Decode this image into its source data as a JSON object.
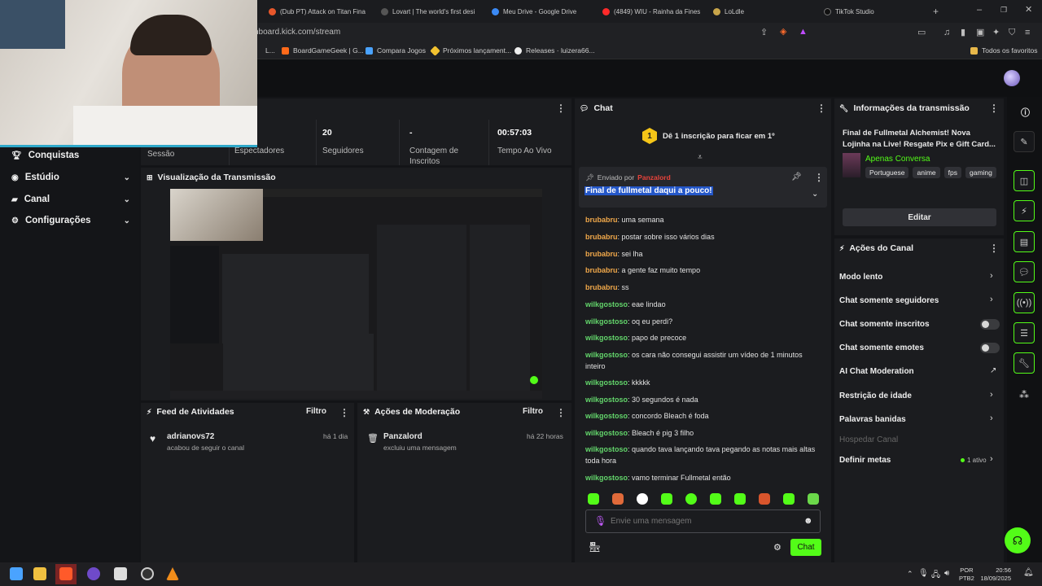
{
  "browser": {
    "tabs": [
      "(Dub PT) Attack on Titan Fina",
      "Lovart | The world's first desi",
      "Meu Drive - Google Drive",
      "(4849) WIU - Rainha da Fines",
      "LoLdle",
      "TikTok Studio"
    ],
    "url": "nboard.kick.com/stream",
    "bookmarks": [
      "L...",
      "BoardGameGeek | G...",
      "Compara Jogos",
      "Próximos lançament...",
      "Releases · luizera66..."
    ],
    "bookmarks_all": "Todos os favoritos"
  },
  "sidebar": {
    "items": [
      {
        "label": "Conquistas",
        "icon": "trophy-icon"
      },
      {
        "label": "Estúdio",
        "icon": "studio-icon"
      },
      {
        "label": "Canal",
        "icon": "channel-icon"
      },
      {
        "label": "Configurações",
        "icon": "gear-icon"
      }
    ]
  },
  "stats": {
    "session_label": "Sessão",
    "viewers": {
      "value": "",
      "label": "Espectadores"
    },
    "followers": {
      "value": "20",
      "label": "Seguidores"
    },
    "subs": {
      "value": "-",
      "label": "Contagem de Inscritos"
    },
    "uptime": {
      "value": "00:57:03",
      "label": "Tempo Ao Vivo"
    }
  },
  "preview": {
    "title": "Visualização da Transmissão"
  },
  "activity": {
    "title": "Feed de Atividades",
    "filter": "Filtro",
    "user": "adrianovs72",
    "action": "acabou de seguir o canal",
    "time": "há 1 dia"
  },
  "moderation": {
    "title": "Ações de Moderação",
    "filter": "Filtro",
    "user": "Panzalord",
    "action": "excluiu uma mensagem",
    "time": "há 22 horas"
  },
  "chat": {
    "title": "Chat",
    "sub_badge": "1",
    "sub_goal": "Dê 1 inscrição para ficar em 1º",
    "pinned_by_label": "Enviado por",
    "pinned_by": "Panzalord",
    "pinned_msg": "Final de fullmetal daqui a pouco!",
    "messages": [
      {
        "user": "brubabru",
        "text": "uma semana"
      },
      {
        "user": "brubabru",
        "text": "postar sobre isso vários dias"
      },
      {
        "user": "brubabru",
        "text": "sei lha"
      },
      {
        "user": "brubabru",
        "text": "a gente faz muito tempo"
      },
      {
        "user": "brubabru",
        "text": "ss"
      },
      {
        "user": "wilkgostoso",
        "text": "eae lindao"
      },
      {
        "user": "wilkgostoso",
        "text": "oq eu perdi?"
      },
      {
        "user": "wilkgostoso",
        "text": "papo de precoce"
      },
      {
        "user": "wilkgostoso",
        "text": "os cara não consegui assistir um vídeo de 1 minutos inteiro"
      },
      {
        "user": "wilkgostoso",
        "text": "kkkkk"
      },
      {
        "user": "wilkgostoso",
        "text": "30 segundos é nada"
      },
      {
        "user": "wilkgostoso",
        "text": "concordo Bleach é foda"
      },
      {
        "user": "wilkgostoso",
        "text": "Bleach é pig 3 filho"
      },
      {
        "user": "wilkgostoso",
        "text": "quando tava lançando tava pegando as notas mais altas toda hora"
      },
      {
        "user": "wilkgostoso",
        "text": "vamo terminar Fullmetal então"
      }
    ],
    "input_placeholder": "Envie uma mensagem",
    "send": "Chat"
  },
  "info": {
    "title": "Informações da transmissão",
    "stream_title": "Final de Fullmetal Alchemist! Nova Lojinha na Live! Resgate Pix e Gift Card...",
    "category": "Apenas Conversa",
    "tags": [
      "Portuguese",
      "anime",
      "fps",
      "gaming"
    ],
    "edit": "Editar"
  },
  "actions": {
    "title": "Ações do Canal",
    "rows": [
      "Modo lento",
      "Chat somente seguidores",
      "Chat somente inscritos",
      "Chat somente emotes",
      "AI Chat Moderation",
      "Restrição de idade",
      "Palavras banidas",
      "Hospedar Canal",
      "Definir metas"
    ],
    "goals_active": "1 ativo"
  },
  "taskbar": {
    "lang1": "POR",
    "lang2": "PTB2",
    "time": "20:56",
    "date": "18/09/2025"
  },
  "colors": {
    "accent": "#53fc18",
    "orange_user": "#f0a84a",
    "green_user": "#63d66b"
  }
}
